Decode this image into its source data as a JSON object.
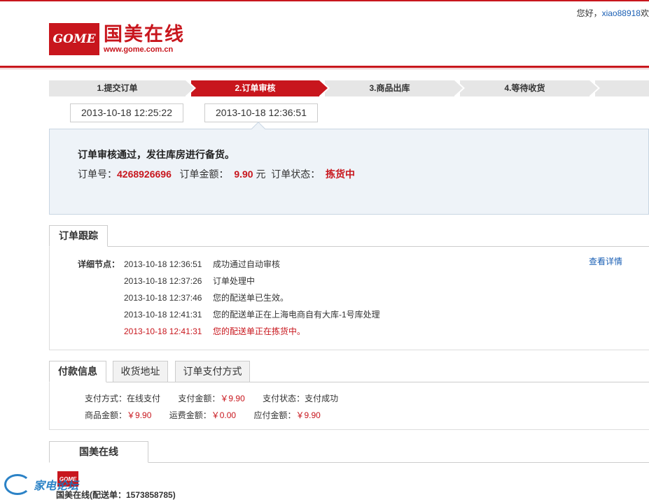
{
  "header": {
    "greeting_prefix": "您好，",
    "username": "xiao88918",
    "greeting_suffix": "欢",
    "logo_badge": "GOME",
    "logo_name": "国美在线",
    "logo_url": "www.gome.com.cn"
  },
  "steps": [
    {
      "label": "1.提交订单",
      "active": false
    },
    {
      "label": "2.订单审核",
      "active": true
    },
    {
      "label": "3.商品出库",
      "active": false
    },
    {
      "label": "4.等待收货",
      "active": false
    }
  ],
  "step_times": [
    "2013-10-18 12:25:22",
    "2013-10-18 12:36:51"
  ],
  "status": {
    "title": "订单审核通过，发往库房进行备货。",
    "order_no_label": "订单号：",
    "order_no": "4268926696",
    "amount_label": "订单金额：",
    "amount": "9.90",
    "amount_unit": "元",
    "status_label": "订单状态：",
    "status_value": "拣货中"
  },
  "tracking": {
    "tab": "订单跟踪",
    "detail_label": "详细节点：",
    "view_details": "查看详情",
    "rows": [
      {
        "time": "2013-10-18 12:36:51",
        "text": "成功通过自动审核"
      },
      {
        "time": "2013-10-18 12:37:26",
        "text": "订单处理中"
      },
      {
        "time": "2013-10-18 12:37:46",
        "text": "您的配送单已生效。"
      },
      {
        "time": "2013-10-18 12:41:31",
        "text": "您的配送单正在上海电商自有大库-1号库处理"
      },
      {
        "time": "2013-10-18 12:41:31",
        "text": "您的配送单正在拣货中。"
      }
    ]
  },
  "payment": {
    "tabs": [
      "付款信息",
      "收货地址",
      "订单支付方式"
    ],
    "method_label": "支付方式：",
    "method": "在线支付",
    "paid_label": "支付金额：",
    "paid": "￥9.90",
    "pay_status_label": "支付状态：",
    "pay_status": "支付成功",
    "goods_label": "商品金额：",
    "goods": "￥9.90",
    "shipping_label": "运费金额：",
    "shipping": "￥0.00",
    "due_label": "应付金额：",
    "due": "￥9.90"
  },
  "shipment": {
    "tab": "国美在线",
    "logo_badge": "GOME",
    "title": "国美在线(配送单：1573858785)"
  },
  "watermark": {
    "text": "家电论坛"
  }
}
